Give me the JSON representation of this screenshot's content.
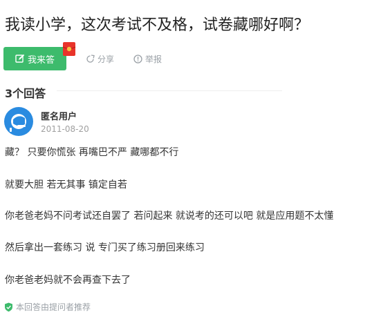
{
  "question": {
    "title": "我读小学，这次考试不及格，试卷藏哪好啊？"
  },
  "toolbar": {
    "answer_label": "我来答",
    "share_label": "分享",
    "report_label": "举报"
  },
  "answers": {
    "count_label": "3个回答"
  },
  "answer": {
    "user_name": "匿名用户",
    "date": "2011-08-20",
    "paragraphs": [
      "藏？ 只要你慌张 再嘴巴不严 藏哪都不行",
      "就要大胆 若无其事 镇定自若",
      "你老爸老妈不问考试还自罢了 若问起来 就说考的还可以吧 就是应用题不太懂",
      "然后拿出一套练习 说 专门买了练习册回来练习",
      "你老爸老妈就不会再查下去了"
    ],
    "footer": "本回答由提问者推荐"
  },
  "colors": {
    "accent_green": "#3dbb6c",
    "avatar_blue": "#2a8be0",
    "muted_gray": "#9aa0a6"
  }
}
